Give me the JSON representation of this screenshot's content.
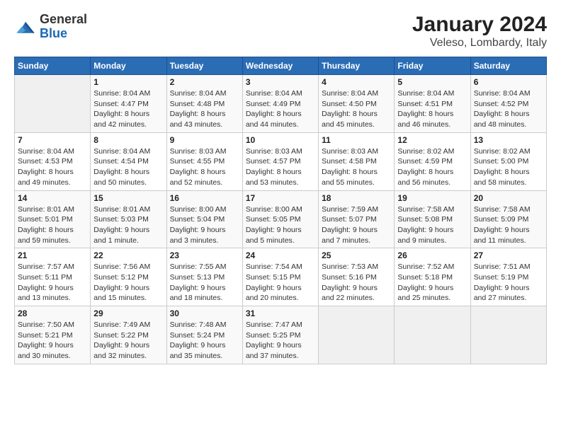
{
  "header": {
    "logo_general": "General",
    "logo_blue": "Blue",
    "title": "January 2024",
    "subtitle": "Veleso, Lombardy, Italy"
  },
  "weekdays": [
    "Sunday",
    "Monday",
    "Tuesday",
    "Wednesday",
    "Thursday",
    "Friday",
    "Saturday"
  ],
  "weeks": [
    [
      {
        "day": "",
        "info": ""
      },
      {
        "day": "1",
        "info": "Sunrise: 8:04 AM\nSunset: 4:47 PM\nDaylight: 8 hours\nand 42 minutes."
      },
      {
        "day": "2",
        "info": "Sunrise: 8:04 AM\nSunset: 4:48 PM\nDaylight: 8 hours\nand 43 minutes."
      },
      {
        "day": "3",
        "info": "Sunrise: 8:04 AM\nSunset: 4:49 PM\nDaylight: 8 hours\nand 44 minutes."
      },
      {
        "day": "4",
        "info": "Sunrise: 8:04 AM\nSunset: 4:50 PM\nDaylight: 8 hours\nand 45 minutes."
      },
      {
        "day": "5",
        "info": "Sunrise: 8:04 AM\nSunset: 4:51 PM\nDaylight: 8 hours\nand 46 minutes."
      },
      {
        "day": "6",
        "info": "Sunrise: 8:04 AM\nSunset: 4:52 PM\nDaylight: 8 hours\nand 48 minutes."
      }
    ],
    [
      {
        "day": "7",
        "info": "Sunrise: 8:04 AM\nSunset: 4:53 PM\nDaylight: 8 hours\nand 49 minutes."
      },
      {
        "day": "8",
        "info": "Sunrise: 8:04 AM\nSunset: 4:54 PM\nDaylight: 8 hours\nand 50 minutes."
      },
      {
        "day": "9",
        "info": "Sunrise: 8:03 AM\nSunset: 4:55 PM\nDaylight: 8 hours\nand 52 minutes."
      },
      {
        "day": "10",
        "info": "Sunrise: 8:03 AM\nSunset: 4:57 PM\nDaylight: 8 hours\nand 53 minutes."
      },
      {
        "day": "11",
        "info": "Sunrise: 8:03 AM\nSunset: 4:58 PM\nDaylight: 8 hours\nand 55 minutes."
      },
      {
        "day": "12",
        "info": "Sunrise: 8:02 AM\nSunset: 4:59 PM\nDaylight: 8 hours\nand 56 minutes."
      },
      {
        "day": "13",
        "info": "Sunrise: 8:02 AM\nSunset: 5:00 PM\nDaylight: 8 hours\nand 58 minutes."
      }
    ],
    [
      {
        "day": "14",
        "info": "Sunrise: 8:01 AM\nSunset: 5:01 PM\nDaylight: 8 hours\nand 59 minutes."
      },
      {
        "day": "15",
        "info": "Sunrise: 8:01 AM\nSunset: 5:03 PM\nDaylight: 9 hours\nand 1 minute."
      },
      {
        "day": "16",
        "info": "Sunrise: 8:00 AM\nSunset: 5:04 PM\nDaylight: 9 hours\nand 3 minutes."
      },
      {
        "day": "17",
        "info": "Sunrise: 8:00 AM\nSunset: 5:05 PM\nDaylight: 9 hours\nand 5 minutes."
      },
      {
        "day": "18",
        "info": "Sunrise: 7:59 AM\nSunset: 5:07 PM\nDaylight: 9 hours\nand 7 minutes."
      },
      {
        "day": "19",
        "info": "Sunrise: 7:58 AM\nSunset: 5:08 PM\nDaylight: 9 hours\nand 9 minutes."
      },
      {
        "day": "20",
        "info": "Sunrise: 7:58 AM\nSunset: 5:09 PM\nDaylight: 9 hours\nand 11 minutes."
      }
    ],
    [
      {
        "day": "21",
        "info": "Sunrise: 7:57 AM\nSunset: 5:11 PM\nDaylight: 9 hours\nand 13 minutes."
      },
      {
        "day": "22",
        "info": "Sunrise: 7:56 AM\nSunset: 5:12 PM\nDaylight: 9 hours\nand 15 minutes."
      },
      {
        "day": "23",
        "info": "Sunrise: 7:55 AM\nSunset: 5:13 PM\nDaylight: 9 hours\nand 18 minutes."
      },
      {
        "day": "24",
        "info": "Sunrise: 7:54 AM\nSunset: 5:15 PM\nDaylight: 9 hours\nand 20 minutes."
      },
      {
        "day": "25",
        "info": "Sunrise: 7:53 AM\nSunset: 5:16 PM\nDaylight: 9 hours\nand 22 minutes."
      },
      {
        "day": "26",
        "info": "Sunrise: 7:52 AM\nSunset: 5:18 PM\nDaylight: 9 hours\nand 25 minutes."
      },
      {
        "day": "27",
        "info": "Sunrise: 7:51 AM\nSunset: 5:19 PM\nDaylight: 9 hours\nand 27 minutes."
      }
    ],
    [
      {
        "day": "28",
        "info": "Sunrise: 7:50 AM\nSunset: 5:21 PM\nDaylight: 9 hours\nand 30 minutes."
      },
      {
        "day": "29",
        "info": "Sunrise: 7:49 AM\nSunset: 5:22 PM\nDaylight: 9 hours\nand 32 minutes."
      },
      {
        "day": "30",
        "info": "Sunrise: 7:48 AM\nSunset: 5:24 PM\nDaylight: 9 hours\nand 35 minutes."
      },
      {
        "day": "31",
        "info": "Sunrise: 7:47 AM\nSunset: 5:25 PM\nDaylight: 9 hours\nand 37 minutes."
      },
      {
        "day": "",
        "info": ""
      },
      {
        "day": "",
        "info": ""
      },
      {
        "day": "",
        "info": ""
      }
    ]
  ]
}
